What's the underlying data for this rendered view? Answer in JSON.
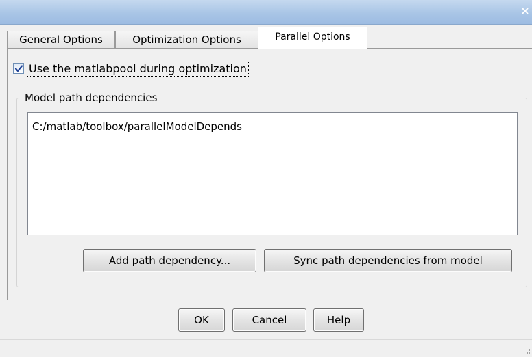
{
  "titlebar": {
    "close_glyph": "×",
    "close_icon": "close-icon"
  },
  "tabs": [
    {
      "label": "General Options",
      "active": false
    },
    {
      "label": "Optimization Options",
      "active": false
    },
    {
      "label": "Parallel Options",
      "active": true
    }
  ],
  "parallel": {
    "use_matlabpool_label": "Use the matlabpool during optimization",
    "use_matlabpool_checked": true,
    "group_title": "Model path dependencies",
    "dependencies": [
      "C:/matlab/toolbox/parallelModelDepends"
    ],
    "add_button": "Add path dependency...",
    "sync_button": "Sync path dependencies from model"
  },
  "footer": {
    "ok_button": "OK",
    "cancel_button": "Cancel",
    "help_button": "Help"
  },
  "colors": {
    "titlebar": "#a9c5e6",
    "window_bg": "#f0f0f0",
    "checkmark": "#1c3f94"
  }
}
